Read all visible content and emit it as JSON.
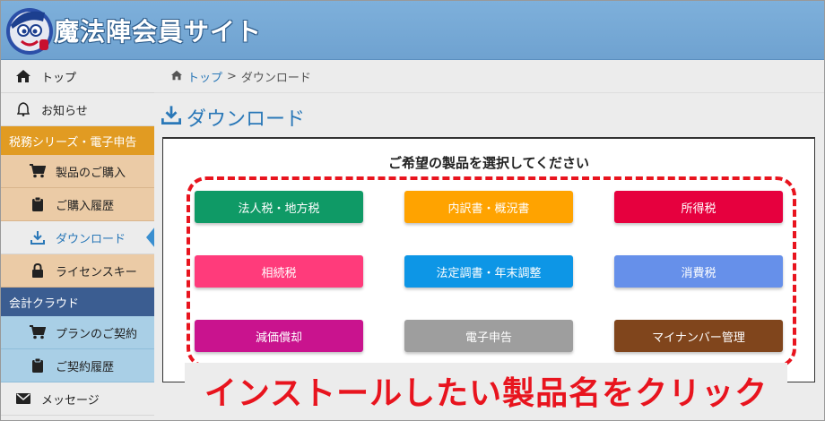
{
  "header": {
    "site_title": "魔法陣会員サイト",
    "bg_color": "#7eb0db"
  },
  "sidebar": {
    "items": [
      {
        "label": "トップ",
        "icon": "home-icon"
      },
      {
        "label": "お知らせ",
        "icon": "bell-icon"
      }
    ],
    "tax_group": {
      "heading": "税務シリーズ・電子申告",
      "color": "#e19b22",
      "items": [
        {
          "label": "製品のご購入",
          "icon": "cart-icon"
        },
        {
          "label": "ご購入履歴",
          "icon": "clipboard-icon"
        },
        {
          "label": "ダウンロード",
          "icon": "download-icon",
          "active": true
        },
        {
          "label": "ライセンスキー",
          "icon": "lock-icon"
        }
      ]
    },
    "cloud_group": {
      "heading": "会計クラウド",
      "color": "#3b5d91",
      "items": [
        {
          "label": "プランのご契約",
          "icon": "cart-icon"
        },
        {
          "label": "ご契約履歴",
          "icon": "clipboard-icon"
        }
      ]
    },
    "message": {
      "label": "メッセージ",
      "icon": "envelope-icon"
    }
  },
  "breadcrumb": {
    "home": "トップ",
    "separator": ">",
    "current": "ダウンロード"
  },
  "page": {
    "title": "ダウンロード",
    "panel_title": "ご希望の製品を選択してください"
  },
  "products": [
    {
      "label": "法人税・地方税",
      "color": "#0f9a66"
    },
    {
      "label": "内訳書・概況書",
      "color": "#ffa300"
    },
    {
      "label": "所得税",
      "color": "#e6003e"
    },
    {
      "label": "相続税",
      "color": "#ff3b7b"
    },
    {
      "label": "法定調書・年末調整",
      "color": "#0d96e6"
    },
    {
      "label": "消費税",
      "color": "#6690ea"
    },
    {
      "label": "減価償却",
      "color": "#c9138e"
    },
    {
      "label": "電子申告",
      "color": "#9e9e9e"
    },
    {
      "label": "マイナンバー管理",
      "color": "#80451c"
    }
  ],
  "annotation": {
    "caption": "インストールしたい製品名をクリック",
    "color": "#e8141e"
  }
}
